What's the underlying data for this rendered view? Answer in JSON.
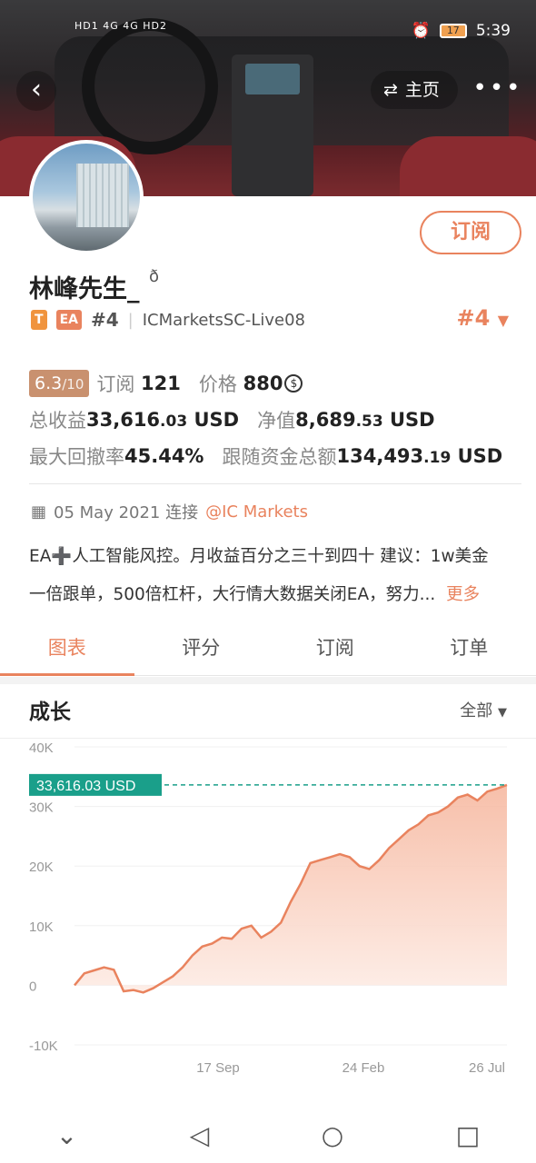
{
  "status_bar": {
    "left": "HD1 4G 4G HD2",
    "time": "5:39",
    "battery": "17"
  },
  "nav": {
    "back_icon": "chevron-left-icon",
    "home_label": "主页",
    "more_icon": "more-dots-icon"
  },
  "profile": {
    "name": "林峰先生_",
    "subscribe_label": "订阅",
    "tags": [
      "T",
      "EA"
    ],
    "rank_small": "#4",
    "server": "ICMarketsSC-Live08",
    "rank_big": "#4"
  },
  "stats": {
    "score": "6.3",
    "score_max": "/10",
    "subscribe_label": "订阅",
    "subscribe_count": "121",
    "price_label": "价格",
    "price_value": "880",
    "total_profit_label": "总收益",
    "total_profit_int": "33,616",
    "total_profit_dec": ".03",
    "total_profit_unit": "USD",
    "net_label": "净值",
    "net_int": "8,689",
    "net_dec": ".53",
    "net_unit": "USD",
    "drawdown_label": "最大回撤率",
    "drawdown_value": "45.44%",
    "follow_label": "跟随资金总额",
    "follow_int": "134,493",
    "follow_dec": ".19",
    "follow_unit": "USD"
  },
  "meta": {
    "date": "05 May 2021 连接",
    "broker": "@IC Markets"
  },
  "description": {
    "line1": "EA➕人工智能风控。月收益百分之三十到四十 建议：1w美金",
    "line2": "一倍跟单，500倍杠杆，大行情大数据关闭EA，努力...",
    "more": "更多"
  },
  "tabs": [
    {
      "label": "图表",
      "active": true
    },
    {
      "label": "评分",
      "active": false
    },
    {
      "label": "订阅",
      "active": false
    },
    {
      "label": "订单",
      "active": false
    }
  ],
  "section": {
    "title": "成长",
    "filter": "全部"
  },
  "chart_data": {
    "type": "area",
    "y_ticks": [
      "40K",
      "30K",
      "20K",
      "10K",
      "0",
      "-10K"
    ],
    "x_ticks": [
      "17 Sep",
      "24 Feb",
      "26 Jul"
    ],
    "ylim": [
      -10000,
      40000
    ],
    "current_label": "33,616.03 USD",
    "current_value": 33616.03,
    "colors": {
      "line": "#e9835e",
      "area_top": "#f6b8a0",
      "area_bottom": "#fdece5",
      "marker": "#1a9f8a"
    },
    "values": [
      0,
      2000,
      2500,
      3000,
      2600,
      -1000,
      -800,
      -1200,
      -500,
      500,
      1500,
      3000,
      5000,
      6500,
      7000,
      8000,
      7800,
      9500,
      10000,
      8000,
      9000,
      10500,
      14000,
      17000,
      20500,
      21000,
      21500,
      22000,
      21500,
      20000,
      19500,
      21000,
      23000,
      24500,
      26000,
      27000,
      28500,
      29000,
      30000,
      31500,
      32000,
      31000,
      32500,
      33000,
      33616
    ]
  },
  "system_nav": {
    "icons": [
      "chevron-down-icon",
      "back-triangle-icon",
      "home-circle-icon",
      "recents-square-icon"
    ]
  }
}
